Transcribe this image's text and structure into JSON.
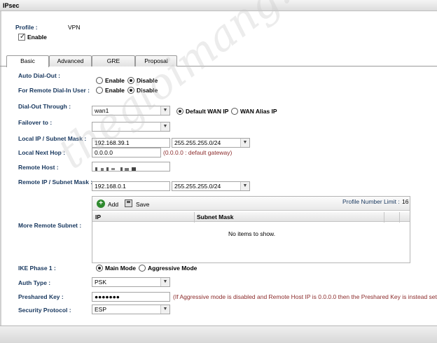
{
  "window": {
    "title": "IPsec"
  },
  "profile": {
    "label": "Profile :",
    "value": "VPN"
  },
  "enable": {
    "label": "Enable",
    "checked": true
  },
  "tabs": [
    {
      "label": "Basic",
      "active": true
    },
    {
      "label": "Advanced",
      "active": false
    },
    {
      "label": "GRE",
      "active": false
    },
    {
      "label": "Proposal",
      "active": false
    }
  ],
  "auto_dial_out": {
    "label": "Auto Dial-Out :",
    "enable": "Enable",
    "disable": "Disable",
    "selected": "Disable"
  },
  "remote_dial_in": {
    "label": "For Remote Dial-In User :",
    "enable": "Enable",
    "disable": "Disable",
    "selected": "Disable"
  },
  "dial_out_through": {
    "label": "Dial-Out Through :",
    "value": "wan1",
    "default_wan_ip": "Default WAN IP",
    "wan_alias_ip": "WAN Alias IP",
    "selected": "Default WAN IP"
  },
  "failover": {
    "label": "Failover to :",
    "value": ""
  },
  "local_ip": {
    "label": "Local IP / Subnet Mask :",
    "ip": "192.168.39.1",
    "mask": "255.255.255.0/24"
  },
  "local_next_hop": {
    "label": "Local Next Hop :",
    "value": "0.0.0.0",
    "note": "(0.0.0.0 : default gateway)"
  },
  "remote_host": {
    "label": "Remote Host :",
    "value": ""
  },
  "remote_ip": {
    "label": "Remote IP / Subnet Mask :",
    "ip": "192.168.0.1",
    "mask": "255.255.255.0/24"
  },
  "more_remote_subnet": {
    "label": "More Remote Subnet :",
    "add": "Add",
    "save": "Save",
    "limit_label": "Profile Number Limit :",
    "limit_value": "16",
    "col_ip": "IP",
    "col_mask": "Subnet Mask",
    "empty": "No items to show."
  },
  "ike_phase1": {
    "label": "IKE Phase 1 :",
    "main": "Main Mode",
    "aggressive": "Aggressive Mode",
    "selected": "Main Mode"
  },
  "auth_type": {
    "label": "Auth Type :",
    "value": "PSK"
  },
  "preshared_key": {
    "label": "Preshared Key :",
    "value": "●●●●●●●",
    "note": "(If Aggressive mode is disabled and Remote Host IP is 0.0.0.0 then the Preshared Key is instead set vi"
  },
  "security_protocol": {
    "label": "Security Protocol :",
    "value": "ESP"
  },
  "watermark": "thegioimang.vn"
}
